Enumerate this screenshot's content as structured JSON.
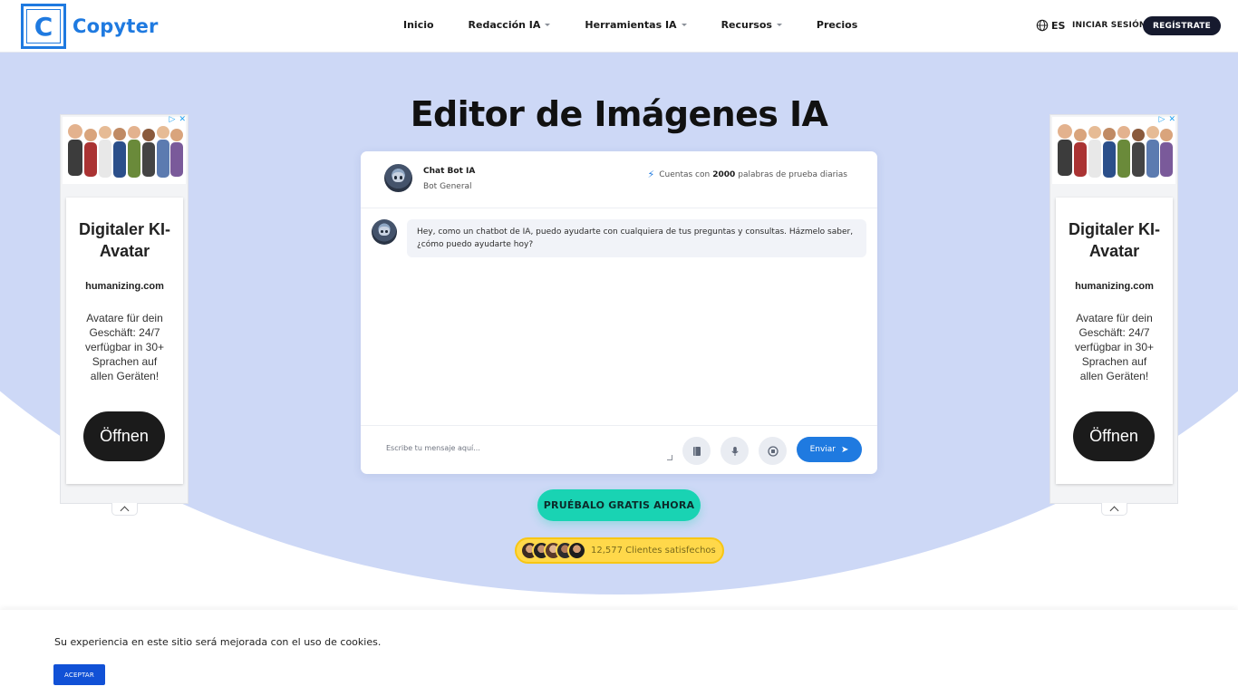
{
  "brand": {
    "logo_letter": "C",
    "name": "Copyter",
    "color": "#1f7ae0"
  },
  "nav": [
    {
      "label": "Inicio",
      "dropdown": false
    },
    {
      "label": "Redacción IA",
      "dropdown": true
    },
    {
      "label": "Herramientas IA",
      "dropdown": true
    },
    {
      "label": "Recursos",
      "dropdown": true
    },
    {
      "label": "Precios",
      "dropdown": false
    }
  ],
  "header": {
    "lang": "ES",
    "login_label": "INICIAR SESIÓN",
    "signup_label": "REGÍSTRATE"
  },
  "hero": {
    "title": "Editor de Imágenes IA"
  },
  "chat": {
    "bot_name": "Chat Bot IA",
    "bot_type": "Bot General",
    "info_prefix": "Cuentas con",
    "info_count": "2000",
    "info_suffix": "palabras de prueba diarias",
    "message": "Hey, como un chatbot de IA, puedo ayudarte con cualquiera de tus preguntas y consultas. Házmelo saber, ¿cómo puedo ayudarte hoy?",
    "input_placeholder": "Escribe tu mensaje aquí...",
    "send_label": "Enviar",
    "icons": [
      "book-icon",
      "microphone-icon",
      "stop-icon"
    ]
  },
  "cta": {
    "label": "PRUÉBALO GRATIS AHORA"
  },
  "clients": {
    "label": "12,577 Clientes satisfechos"
  },
  "ads": [
    {
      "title": "Digitaler KI-Avatar",
      "domain": "humanizing.com",
      "text": "Avatare für dein Geschäft: 24/7 verfügbar in 30+ Sprachen auf allen Geräten!",
      "button": "Öffnen"
    },
    {
      "title": "Digitaler KI-Avatar",
      "domain": "humanizing.com",
      "text": "Avatare für dein Geschäft: 24/7 verfügbar in 30+ Sprachen auf allen Geräten!",
      "button": "Öffnen"
    }
  ],
  "cookie": {
    "text": "Su experiencia en este sitio será mejorada con el uso de cookies.",
    "accept_label": "ACEPTAR"
  },
  "colors": {
    "hero_bg": "#cdd8f6",
    "cta": "#19d3b3",
    "clients_badge": "#ffd84a",
    "accept": "#1151d6"
  }
}
